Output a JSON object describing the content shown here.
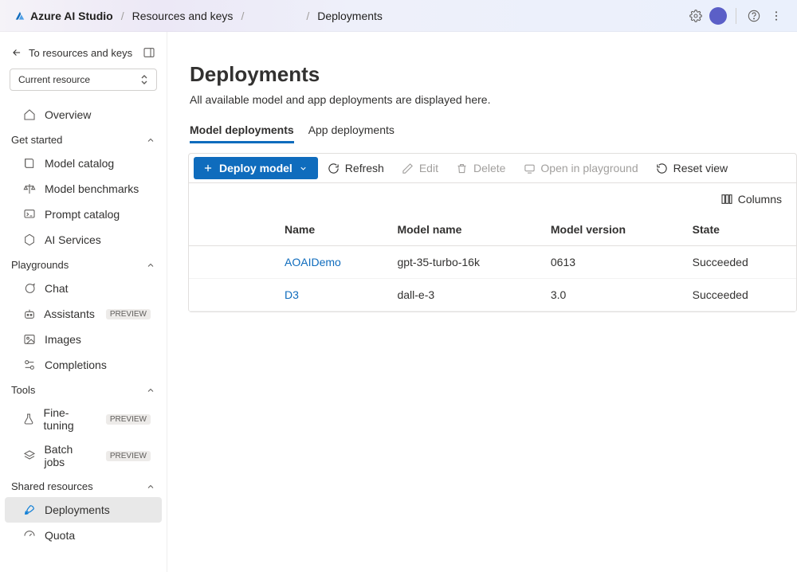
{
  "topbar": {
    "brand": "Azure AI Studio",
    "crumb1": "Resources and keys",
    "crumb2": "Deployments"
  },
  "sidebar": {
    "back_label": "To resources and keys",
    "resource_label": "Current resource",
    "nav_overview": "Overview",
    "group_get_started": "Get started",
    "nav_model_catalog": "Model catalog",
    "nav_model_benchmarks": "Model benchmarks",
    "nav_prompt_catalog": "Prompt catalog",
    "nav_ai_services": "AI Services",
    "group_playgrounds": "Playgrounds",
    "nav_chat": "Chat",
    "nav_assistants": "Assistants",
    "nav_images": "Images",
    "nav_completions": "Completions",
    "group_tools": "Tools",
    "nav_fine_tuning": "Fine-tuning",
    "nav_batch_jobs": "Batch jobs",
    "group_shared": "Shared resources",
    "nav_deployments": "Deployments",
    "nav_quota": "Quota",
    "badge_preview": "PREVIEW"
  },
  "page": {
    "title": "Deployments",
    "subtitle": "All available model and app deployments are displayed here.",
    "tab_model": "Model deployments",
    "tab_app": "App deployments"
  },
  "commands": {
    "deploy": "Deploy model",
    "refresh": "Refresh",
    "edit": "Edit",
    "delete": "Delete",
    "open_playground": "Open in playground",
    "reset_view": "Reset view",
    "columns": "Columns"
  },
  "table": {
    "headers": {
      "name": "Name",
      "model_name": "Model name",
      "model_version": "Model version",
      "state": "State"
    },
    "rows": [
      {
        "name": "AOAIDemo",
        "model_name": "gpt-35-turbo-16k",
        "model_version": "0613",
        "state": "Succeeded"
      },
      {
        "name": "D3",
        "model_name": "dall-e-3",
        "model_version": "3.0",
        "state": "Succeeded"
      }
    ]
  }
}
